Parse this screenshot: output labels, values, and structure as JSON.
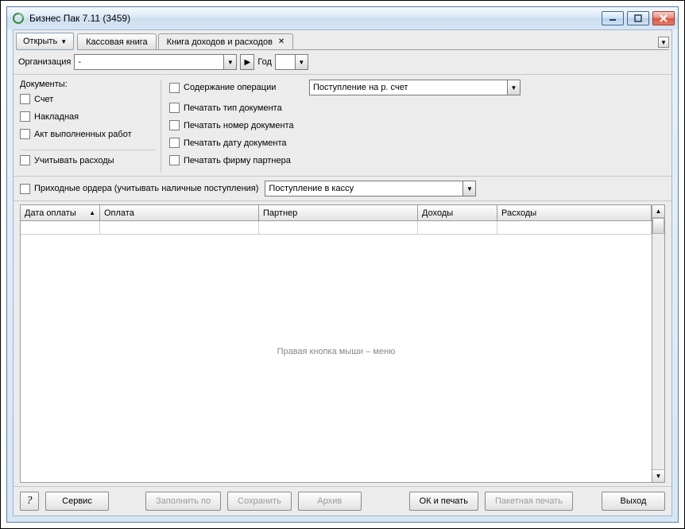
{
  "titlebar": {
    "title": "Бизнес Пак 7.11 (3459)"
  },
  "toolbar": {
    "open_label": "Открыть"
  },
  "tabs": [
    {
      "label": "Кассовая книга"
    },
    {
      "label": "Книга доходов и расходов"
    }
  ],
  "org": {
    "label": "Организация",
    "value": "-",
    "year_label": "Год",
    "year_value": ""
  },
  "docs": {
    "header": "Документы:",
    "items": [
      {
        "label": "Счет"
      },
      {
        "label": "Накладная"
      },
      {
        "label": "Акт выполненных работ"
      }
    ],
    "expenses_label": "Учитывать расходы"
  },
  "opts": {
    "operation_content_label": "Содержание операции",
    "operation_content_value": "Поступление на р. счет",
    "print_doc_type": "Печатать тип документа",
    "print_doc_number": "Печатать номер документа",
    "print_doc_date": "Печатать дату документа",
    "print_partner_firm": "Печатать фирму партнера"
  },
  "orders": {
    "label": "Приходные ордера (учитывать наличные поступления)",
    "value": "Поступление в кассу"
  },
  "grid": {
    "columns": {
      "date": "Дата оплаты",
      "payment": "Оплата",
      "partner": "Партнер",
      "income": "Доходы",
      "expense": "Расходы"
    },
    "hint": "Правая кнопка мыши – меню"
  },
  "buttons": {
    "service": "Сервис",
    "fill_by": "Заполнить по",
    "save": "Сохранить",
    "archive": "Архив",
    "ok_print": "ОК и печать",
    "batch_print": "Пакетная печать",
    "exit": "Выход"
  }
}
